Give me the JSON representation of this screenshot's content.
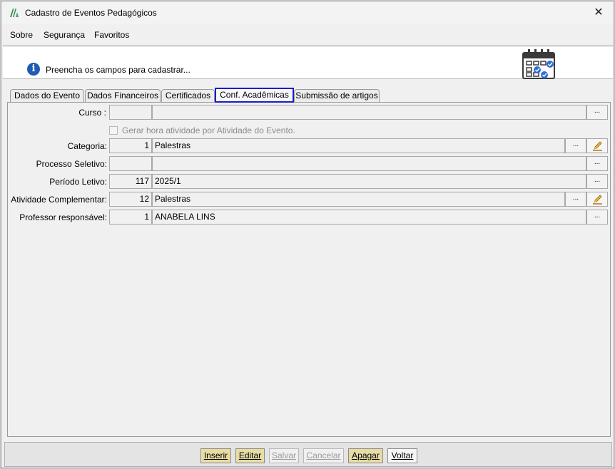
{
  "window": {
    "title": "Cadastro de Eventos Pedagógicos",
    "close_glyph": "✕"
  },
  "menu": [
    "Sobre",
    "Segurança",
    "Favoritos"
  ],
  "header": {
    "message": "Preencha os campos para cadastrar...",
    "info_icon": "info-icon",
    "calendar_icon": "calendar-icon"
  },
  "tabs": [
    {
      "label": "Dados do Evento",
      "active": false
    },
    {
      "label": "Dados Financeiros",
      "active": false
    },
    {
      "label": "Certificados",
      "active": false
    },
    {
      "label": "Conf. Acadêmicas",
      "active": true
    },
    {
      "label": "Submissão de artigos",
      "active": false
    }
  ],
  "form": {
    "curso": {
      "label": "Curso :",
      "code": "",
      "value": ""
    },
    "gerar_hora": {
      "label": "Gerar hora atividade por Atividade do Evento.",
      "checked": false,
      "enabled": false
    },
    "categoria": {
      "label": "Categoria:",
      "code": "1",
      "value": "Palestras"
    },
    "processo_seletivo": {
      "label": "Processo Seletivo:",
      "code": "",
      "value": ""
    },
    "periodo_letivo": {
      "label": "Período Letivo:",
      "code": "117",
      "value": "2025/1"
    },
    "atividade_complementar": {
      "label": "Atividade Complementar:",
      "code": "12",
      "value": "Palestras"
    },
    "professor_responsavel": {
      "label": "Professor responsável:",
      "code": "1",
      "value": "ANABELA LINS"
    },
    "lookup_label": "..."
  },
  "actions": {
    "inserir": "Inserir",
    "editar": "Editar",
    "salvar": "Salvar",
    "cancelar": "Cancelar",
    "apagar": "Apagar",
    "voltar": "Voltar"
  },
  "colors": {
    "active_tab_border": "#1a1ad0",
    "enabled_action": "#e8dca4",
    "info_icon": "#1e5bb5"
  }
}
